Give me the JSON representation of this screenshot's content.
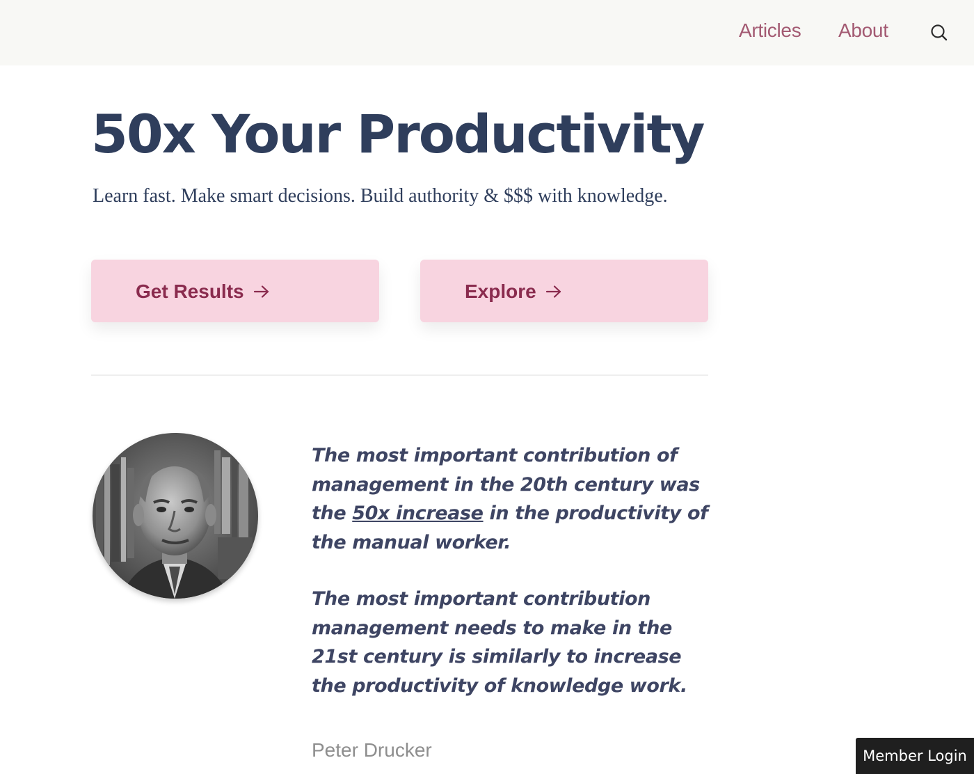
{
  "nav": {
    "articles_label": "Articles",
    "about_label": "About",
    "search_icon": "search-icon"
  },
  "hero": {
    "title": "50x Your Productivity",
    "subtitle": "Learn fast. Make smart decisions. Build authority & $$$ with knowledge."
  },
  "cta": {
    "get_results_label": "Get Results",
    "explore_label": "Explore",
    "arrow_icon": "arrow-right-icon"
  },
  "quote": {
    "p1_before": "The most important contribution of management in the 20th century was the ",
    "p1_link": "50x increase",
    "p1_after": " in the productivity of the manual worker.",
    "p2": "The most important contribution management needs to make in the 21st century is similarly to increase the productivity of knowledge work.",
    "author": "Peter Drucker"
  },
  "footer": {
    "member_login_label": "Member Login"
  },
  "colors": {
    "topbar_bg": "#f8f8f5",
    "nav_link": "#a35a72",
    "heading": "#2f3e5c",
    "cta_bg": "#f8d4e0",
    "cta_text": "#8a2b4e",
    "quote_text": "#3e4563",
    "author_text": "#8e8e8e",
    "member_login_bg": "#1f1f1f"
  }
}
